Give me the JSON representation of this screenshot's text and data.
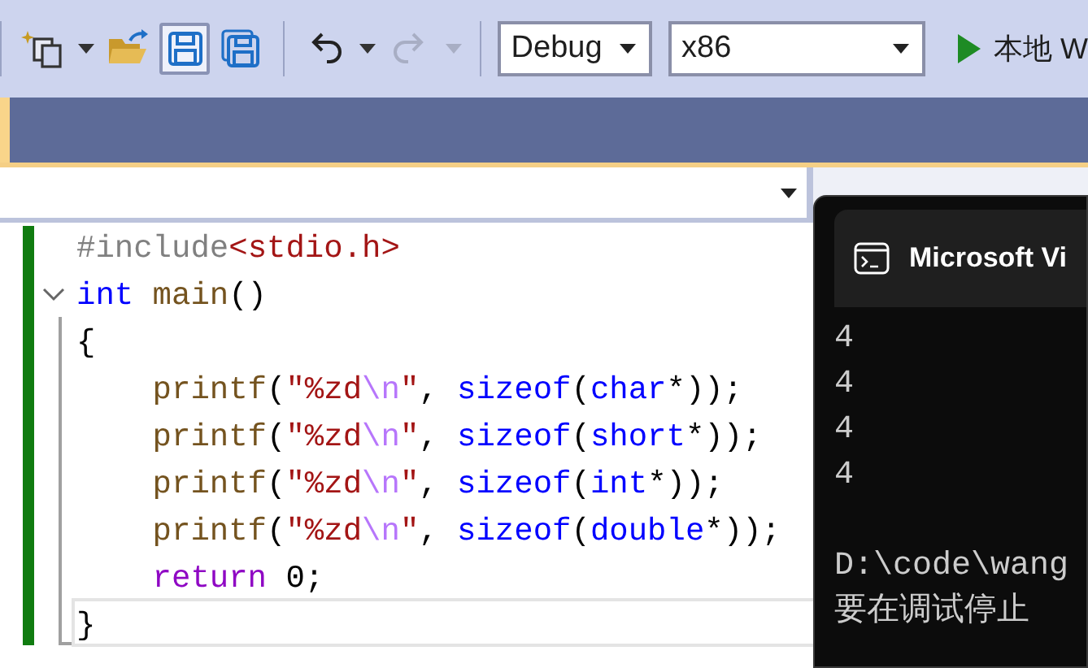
{
  "toolbar": {
    "items": [
      {
        "kind": "new-project",
        "caret": true,
        "selected": false
      },
      {
        "kind": "open",
        "caret": false,
        "selected": false
      },
      {
        "kind": "save",
        "caret": false,
        "selected": true
      },
      {
        "kind": "save-all",
        "caret": false,
        "selected": false
      },
      {
        "kind": "separator"
      },
      {
        "kind": "undo",
        "caret": true,
        "selected": false,
        "disabled": false
      },
      {
        "kind": "redo",
        "caret": true,
        "selected": false,
        "disabled": true
      },
      {
        "kind": "separator"
      }
    ],
    "configuration": "Debug",
    "platform": "x86",
    "run_label": "本地 W"
  },
  "editor": {
    "lines": [
      {
        "foldable": false,
        "indented": false,
        "tokens": [
          {
            "kind": "preproc",
            "text": "#include"
          },
          {
            "kind": "string",
            "text": "<stdio.h>"
          }
        ]
      },
      {
        "foldable": true,
        "indented": false,
        "tokens": [
          {
            "kind": "keyword",
            "text": "int"
          },
          {
            "kind": "function",
            "text": "main",
            "space_before": true
          },
          {
            "kind": "plain",
            "text": "()"
          }
        ]
      },
      {
        "foldable": false,
        "indented": false,
        "tokens": [
          {
            "kind": "plain",
            "text": "{"
          }
        ]
      },
      {
        "foldable": false,
        "indented": true,
        "tokens": [
          {
            "kind": "function",
            "text": "printf"
          },
          {
            "kind": "plain",
            "text": "("
          },
          {
            "kind": "string",
            "text": "\"%zd"
          },
          {
            "kind": "escape",
            "text": "\\n"
          },
          {
            "kind": "string",
            "text": "\""
          },
          {
            "kind": "plain",
            "text": ","
          },
          {
            "kind": "keyword",
            "text": "sizeof",
            "space_before": true
          },
          {
            "kind": "plain",
            "text": "("
          },
          {
            "kind": "keyword",
            "text": "char"
          },
          {
            "kind": "plain",
            "text": "*));"
          }
        ]
      },
      {
        "foldable": false,
        "indented": true,
        "tokens": [
          {
            "kind": "function",
            "text": "printf"
          },
          {
            "kind": "plain",
            "text": "("
          },
          {
            "kind": "string",
            "text": "\"%zd"
          },
          {
            "kind": "escape",
            "text": "\\n"
          },
          {
            "kind": "string",
            "text": "\""
          },
          {
            "kind": "plain",
            "text": ","
          },
          {
            "kind": "keyword",
            "text": "sizeof",
            "space_before": true
          },
          {
            "kind": "plain",
            "text": "("
          },
          {
            "kind": "keyword",
            "text": "short"
          },
          {
            "kind": "plain",
            "text": "*));"
          }
        ]
      },
      {
        "foldable": false,
        "indented": true,
        "tokens": [
          {
            "kind": "function",
            "text": "printf"
          },
          {
            "kind": "plain",
            "text": "("
          },
          {
            "kind": "string",
            "text": "\"%zd"
          },
          {
            "kind": "escape",
            "text": "\\n"
          },
          {
            "kind": "string",
            "text": "\""
          },
          {
            "kind": "plain",
            "text": ","
          },
          {
            "kind": "keyword",
            "text": "sizeof",
            "space_before": true
          },
          {
            "kind": "plain",
            "text": "("
          },
          {
            "kind": "keyword",
            "text": "int"
          },
          {
            "kind": "plain",
            "text": "*));"
          }
        ]
      },
      {
        "foldable": false,
        "indented": true,
        "tokens": [
          {
            "kind": "function",
            "text": "printf"
          },
          {
            "kind": "plain",
            "text": "("
          },
          {
            "kind": "string",
            "text": "\"%zd"
          },
          {
            "kind": "escape",
            "text": "\\n"
          },
          {
            "kind": "string",
            "text": "\""
          },
          {
            "kind": "plain",
            "text": ","
          },
          {
            "kind": "keyword",
            "text": "sizeof",
            "space_before": true
          },
          {
            "kind": "plain",
            "text": "("
          },
          {
            "kind": "keyword",
            "text": "double"
          },
          {
            "kind": "plain",
            "text": "*));"
          }
        ]
      },
      {
        "foldable": false,
        "indented": true,
        "tokens": [
          {
            "kind": "control",
            "text": "return"
          },
          {
            "kind": "plain",
            "text": "0;",
            "space_before": true
          }
        ]
      },
      {
        "foldable": false,
        "indented": false,
        "tokens": [
          {
            "kind": "plain",
            "text": "}"
          }
        ]
      }
    ]
  },
  "console": {
    "title": "Microsoft Vi",
    "output": [
      "4",
      "4",
      "4",
      "4"
    ],
    "message": [
      "D:\\code\\wang",
      "要在调试停止"
    ]
  }
}
